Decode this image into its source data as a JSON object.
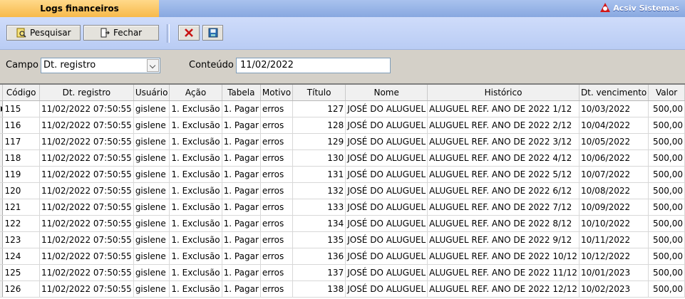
{
  "window": {
    "tab_title": "Logs financeiros",
    "brand": "Acsiv Sistemas"
  },
  "toolbar": {
    "search_label": "Pesquisar",
    "close_label": "Fechar",
    "delete_icon": "x-icon",
    "export_icon": "save-icon"
  },
  "filter": {
    "field_label": "Campo",
    "field_value": "Dt. registro",
    "content_label": "Conteúdo",
    "content_value": "11/02/2022"
  },
  "table": {
    "columns": [
      "Código",
      "Dt. registro",
      "Usuário",
      "Ação",
      "Tabela",
      "Motivo",
      "Título",
      "Nome",
      "Histórico",
      "Dt. vencimento",
      "Valor"
    ],
    "rows": [
      [
        "115",
        "11/02/2022 07:50:55",
        "gislene",
        "1. Exclusão",
        "1. Pagar",
        "erros",
        "127",
        "JOSÉ DO ALUGUEL",
        "ALUGUEL REF. ANO DE 2022 1/12",
        "10/03/2022",
        "500,00"
      ],
      [
        "116",
        "11/02/2022 07:50:55",
        "gislene",
        "1. Exclusão",
        "1. Pagar",
        "erros",
        "128",
        "JOSÉ DO ALUGUEL",
        "ALUGUEL REF. ANO DE 2022 2/12",
        "10/04/2022",
        "500,00"
      ],
      [
        "117",
        "11/02/2022 07:50:55",
        "gislene",
        "1. Exclusão",
        "1. Pagar",
        "erros",
        "129",
        "JOSÉ DO ALUGUEL",
        "ALUGUEL REF. ANO DE 2022 3/12",
        "10/05/2022",
        "500,00"
      ],
      [
        "118",
        "11/02/2022 07:50:55",
        "gislene",
        "1. Exclusão",
        "1. Pagar",
        "erros",
        "130",
        "JOSÉ DO ALUGUEL",
        "ALUGUEL REF. ANO DE 2022 4/12",
        "10/06/2022",
        "500,00"
      ],
      [
        "119",
        "11/02/2022 07:50:55",
        "gislene",
        "1. Exclusão",
        "1. Pagar",
        "erros",
        "131",
        "JOSÉ DO ALUGUEL",
        "ALUGUEL REF. ANO DE 2022 5/12",
        "10/07/2022",
        "500,00"
      ],
      [
        "120",
        "11/02/2022 07:50:55",
        "gislene",
        "1. Exclusão",
        "1. Pagar",
        "erros",
        "132",
        "JOSÉ DO ALUGUEL",
        "ALUGUEL REF. ANO DE 2022 6/12",
        "10/08/2022",
        "500,00"
      ],
      [
        "121",
        "11/02/2022 07:50:55",
        "gislene",
        "1. Exclusão",
        "1. Pagar",
        "erros",
        "133",
        "JOSÉ DO ALUGUEL",
        "ALUGUEL REF. ANO DE 2022 7/12",
        "10/09/2022",
        "500,00"
      ],
      [
        "122",
        "11/02/2022 07:50:55",
        "gislene",
        "1. Exclusão",
        "1. Pagar",
        "erros",
        "134",
        "JOSÉ DO ALUGUEL",
        "ALUGUEL REF. ANO DE 2022 8/12",
        "10/10/2022",
        "500,00"
      ],
      [
        "123",
        "11/02/2022 07:50:55",
        "gislene",
        "1. Exclusão",
        "1. Pagar",
        "erros",
        "135",
        "JOSÉ DO ALUGUEL",
        "ALUGUEL REF. ANO DE 2022 9/12",
        "10/11/2022",
        "500,00"
      ],
      [
        "124",
        "11/02/2022 07:50:55",
        "gislene",
        "1. Exclusão",
        "1. Pagar",
        "erros",
        "136",
        "JOSÉ DO ALUGUEL",
        "ALUGUEL REF. ANO DE 2022 10/12",
        "10/12/2022",
        "500,00"
      ],
      [
        "125",
        "11/02/2022 07:50:55",
        "gislene",
        "1. Exclusão",
        "1. Pagar",
        "erros",
        "137",
        "JOSÉ DO ALUGUEL",
        "ALUGUEL REF. ANO DE 2022 11/12",
        "10/01/2023",
        "500,00"
      ],
      [
        "126",
        "11/02/2022 07:50:55",
        "gislene",
        "1. Exclusão",
        "1. Pagar",
        "erros",
        "138",
        "JOSÉ DO ALUGUEL",
        "ALUGUEL REF. ANO DE 2022 12/12",
        "10/02/2023",
        "500,00"
      ]
    ]
  }
}
